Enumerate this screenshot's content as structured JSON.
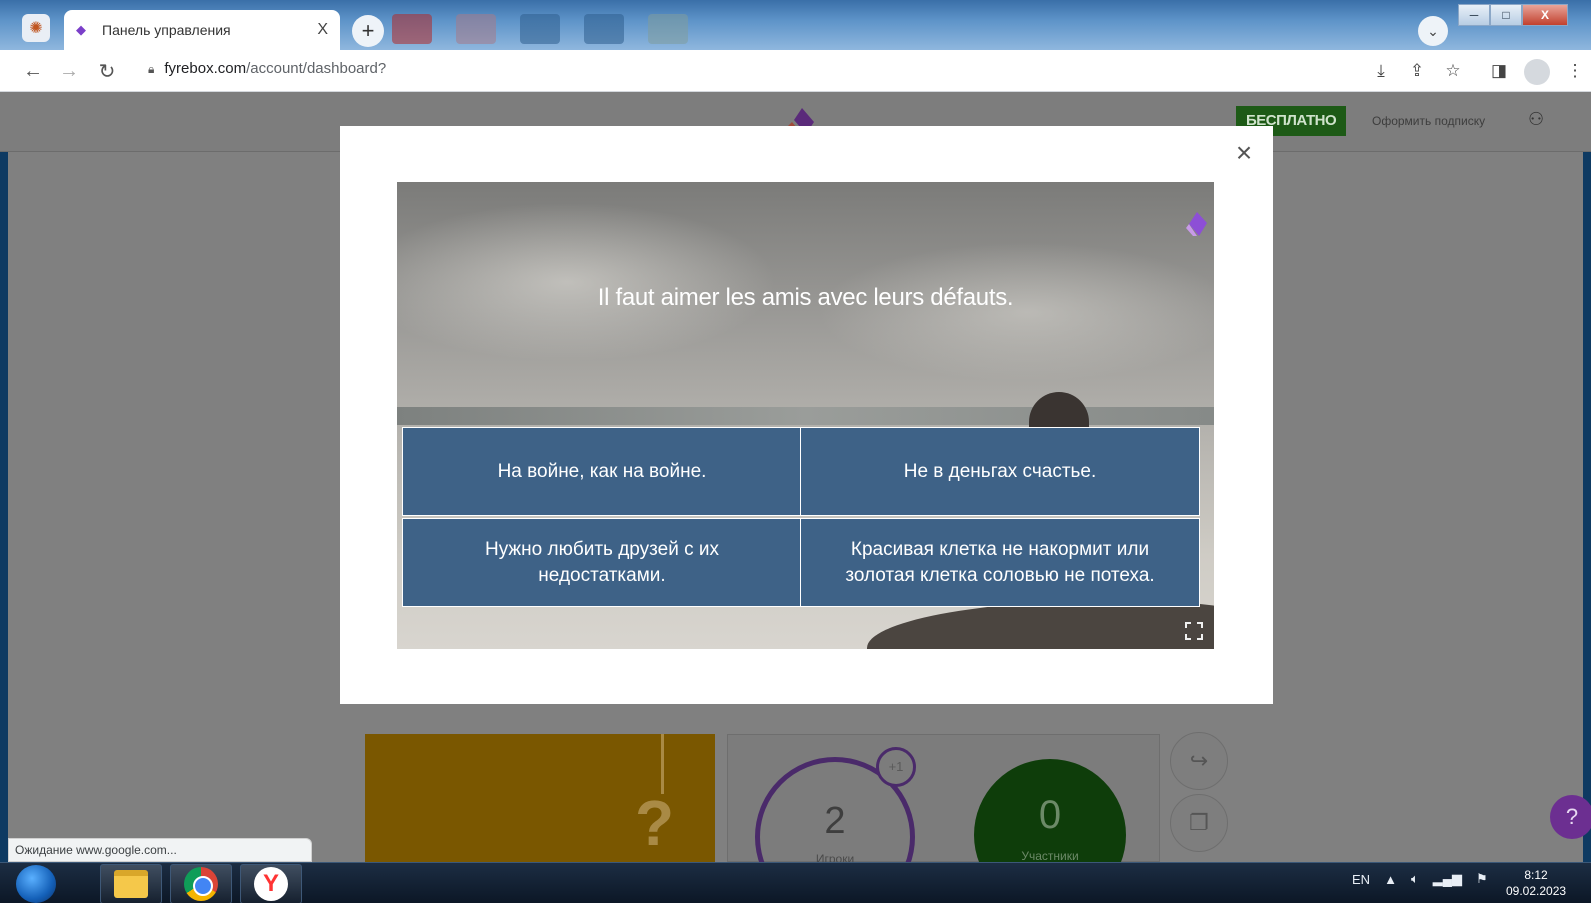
{
  "browser": {
    "tab_title": "Панель управления",
    "tab_close": "X",
    "new_tab": "+",
    "url_host": "fyrebox.com",
    "url_path": "/account/dashboard?",
    "window_controls": [
      "─",
      "□",
      "X"
    ]
  },
  "site": {
    "free_badge": "БЕСПЛАТНО",
    "subscribe_link": "Оформить подписку"
  },
  "quiz": {
    "question": "Il faut aimer les amis avec leurs défauts.",
    "answers": [
      "На войне, как на войне.",
      "Не в деньгах счастье.",
      "Нужно любить друзей с их недостатками.",
      "Красивая клетка не накормит или золотая клетка соловью не потеха."
    ]
  },
  "dashboard": {
    "players_count": "2",
    "players_label": "Игроки",
    "players_delta": "+1",
    "participants_count": "0",
    "participants_label": "Участники"
  },
  "status_bar": "Ожидание www.google.com...",
  "taskbar": {
    "lang": "EN",
    "time": "8:12",
    "date": "09.02.2023"
  },
  "colors": {
    "answer_bg": "#3e6287",
    "free_badge_bg": "#1d5a16",
    "accent_purple": "#6c2f91"
  }
}
